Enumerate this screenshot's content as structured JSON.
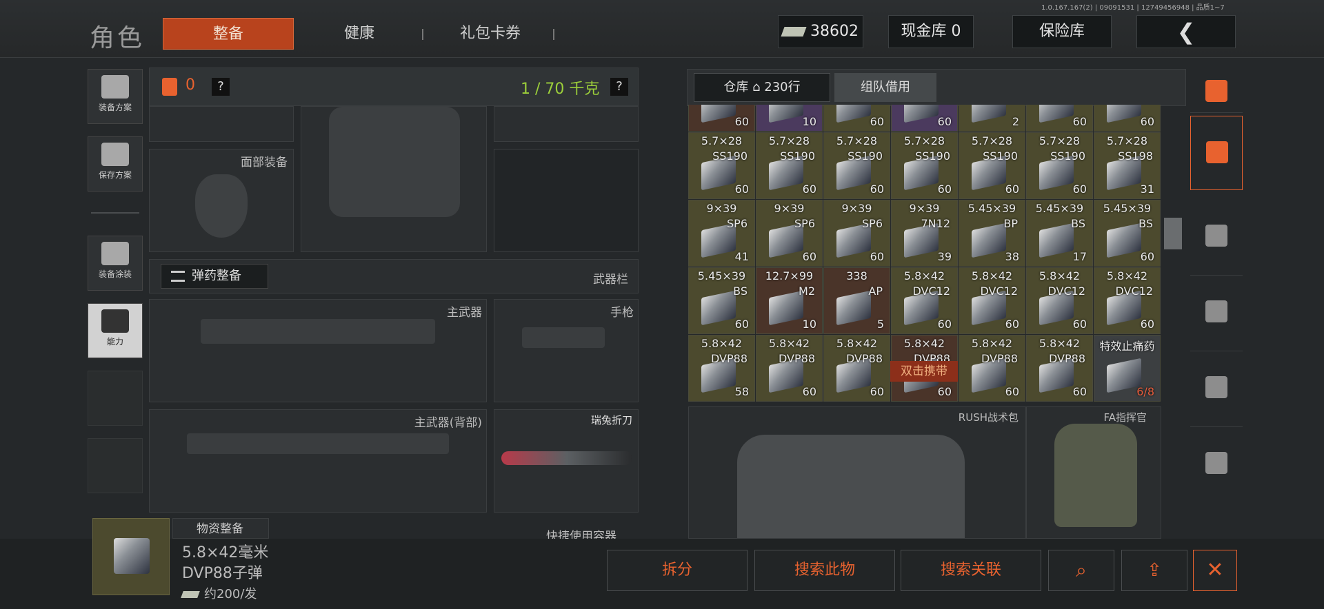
{
  "header": {
    "title": "角色",
    "tabs": [
      "整备",
      "健康",
      "礼包卡券"
    ],
    "version": "1.0.167.167(2) | 09091531 | 127494569​48 | 品质1~7",
    "money": "38602",
    "cash_vault": "现金库 0",
    "insurance": "保险库",
    "back_icon": "chevron-left-icon"
  },
  "left_menu": [
    {
      "label": "装备方案",
      "icon": "vest-icon"
    },
    {
      "label": "保存方案",
      "icon": "download-icon"
    },
    {
      "label": "装备涂装",
      "icon": "helmet-icon"
    },
    {
      "label": "能力",
      "icon": "lightning-icon"
    }
  ],
  "loadout": {
    "backpack_count": "0",
    "help": "?",
    "weight": "1 / 70 千克",
    "face_gear": "面部装备",
    "ammo_button": "弹药整备",
    "weapon_bar": "武器栏",
    "primary": "主武器",
    "pistol": "手枪",
    "primary_back": "主武器(背部)",
    "knife": "瑞兔折刀",
    "supplies": "物资整备",
    "quick_container": "快捷使用容器"
  },
  "warehouse": {
    "tab_label": "仓库",
    "rows": "230行",
    "team_borrow": "组队借用",
    "double_click_hint": "双击携带",
    "rush_bag": "RUSH战术包",
    "fa_bag": "FA指挥官"
  },
  "inventory": [
    {
      "l1": "",
      "l2": "",
      "count": "60",
      "tone": "brown"
    },
    {
      "l1": "",
      "l2": "",
      "count": "10",
      "tone": "purple"
    },
    {
      "l1": "",
      "l2": "",
      "count": "60",
      "tone": "olive"
    },
    {
      "l1": "",
      "l2": "",
      "count": "60",
      "tone": "purple"
    },
    {
      "l1": "",
      "l2": "",
      "count": "2",
      "tone": "olive"
    },
    {
      "l1": "",
      "l2": "",
      "count": "60",
      "tone": "olive"
    },
    {
      "l1": "",
      "l2": "",
      "count": "60",
      "tone": "olive"
    },
    {
      "l1": "5.7×28",
      "l2": "SS190",
      "count": "60",
      "tone": "olive"
    },
    {
      "l1": "5.7×28",
      "l2": "SS190",
      "count": "60",
      "tone": "olive"
    },
    {
      "l1": "5.7×28",
      "l2": "SS190",
      "count": "60",
      "tone": "olive"
    },
    {
      "l1": "5.7×28",
      "l2": "SS190",
      "count": "60",
      "tone": "olive"
    },
    {
      "l1": "5.7×28",
      "l2": "SS190",
      "count": "60",
      "tone": "olive"
    },
    {
      "l1": "5.7×28",
      "l2": "SS190",
      "count": "60",
      "tone": "olive"
    },
    {
      "l1": "5.7×28",
      "l2": "SS198",
      "count": "31",
      "tone": "olive"
    },
    {
      "l1": "9×39",
      "l2": "SP6",
      "count": "41",
      "tone": "olive"
    },
    {
      "l1": "9×39",
      "l2": "SP6",
      "count": "60",
      "tone": "olive"
    },
    {
      "l1": "9×39",
      "l2": "SP6",
      "count": "60",
      "tone": "olive"
    },
    {
      "l1": "9×39",
      "l2": "7N12",
      "count": "39",
      "tone": "olive"
    },
    {
      "l1": "5.45×39",
      "l2": "BP",
      "count": "38",
      "tone": "olive"
    },
    {
      "l1": "5.45×39",
      "l2": "BS",
      "count": "17",
      "tone": "olive"
    },
    {
      "l1": "5.45×39",
      "l2": "BS",
      "count": "60",
      "tone": "olive"
    },
    {
      "l1": "5.45×39",
      "l2": "BS",
      "count": "60",
      "tone": "olive"
    },
    {
      "l1": "12.7×99",
      "l2": "M2",
      "count": "10",
      "tone": "brown"
    },
    {
      "l1": "338",
      "l2": "AP",
      "count": "5",
      "tone": "brown"
    },
    {
      "l1": "5.8×42",
      "l2": "DVC12",
      "count": "60",
      "tone": "olive"
    },
    {
      "l1": "5.8×42",
      "l2": "DVC12",
      "count": "60",
      "tone": "olive"
    },
    {
      "l1": "5.8×42",
      "l2": "DVC12",
      "count": "60",
      "tone": "olive"
    },
    {
      "l1": "5.8×42",
      "l2": "DVC12",
      "count": "60",
      "tone": "olive"
    },
    {
      "l1": "5.8×42",
      "l2": "DVP88",
      "count": "58",
      "tone": "olive"
    },
    {
      "l1": "5.8×42",
      "l2": "DVP88",
      "count": "60",
      "tone": "olive"
    },
    {
      "l1": "5.8×42",
      "l2": "DVP88",
      "count": "60",
      "tone": "olive"
    },
    {
      "l1": "5.8×42",
      "l2": "DVP88",
      "count": "60",
      "tone": "brown"
    },
    {
      "l1": "5.8×42",
      "l2": "DVP88",
      "count": "60",
      "tone": "olive"
    },
    {
      "l1": "5.8×42",
      "l2": "DVP88",
      "count": "60",
      "tone": "olive"
    },
    {
      "l1": "特效止痛药",
      "l2": "",
      "count": "6/8",
      "tone": "gray"
    }
  ],
  "selected_item": {
    "caliber": "5.8×42毫米",
    "name": "DVP88子弹",
    "price": "约200/发"
  },
  "actions": {
    "split": "拆分",
    "search_item": "搜索此物",
    "search_related": "搜索关联"
  }
}
